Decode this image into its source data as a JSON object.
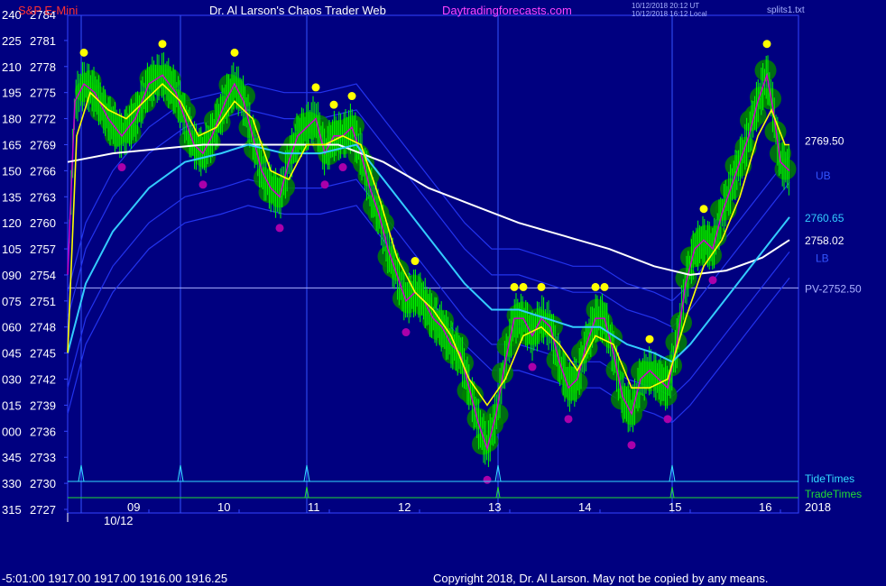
{
  "header": {
    "instrument": "S&P E-Mini",
    "site_title": "Dr. Al Larson's Chaos Trader Web",
    "site_url": "Daytradingforecasts.com",
    "ut_stamp": "10/12/2018 20:12 UT",
    "local_stamp": "10/12/2018 16:12 Local",
    "corner_label": "splits1.txt"
  },
  "footer": {
    "readout": "-5:01:00  1917.00 1917.00 1916.00 1916.25",
    "copyright": "Copyright 2018, Dr. Al Larson. May not be copied by any means."
  },
  "colors": {
    "background": "#000080",
    "price": "#00ff00",
    "blob": "#008000",
    "fast_average": "#ffff00",
    "slow_average": "#ffffff",
    "mid_average": "#33ccff",
    "bands": "#2233ee",
    "magenta": "#cc00cc",
    "dot_high": "#ffff00",
    "dot_low": "#aa00aa"
  },
  "chart_data": {
    "type": "line",
    "y_axis": {
      "ticks": [
        2784,
        2781,
        2778,
        2775,
        2772,
        2769,
        2766,
        2763,
        2760,
        2757,
        2754,
        2751,
        2748,
        2745,
        2742,
        2739,
        2736,
        2733,
        2730,
        2727
      ],
      "degree_labels": [
        "240",
        "225",
        "210",
        "195",
        "180",
        "165",
        "150",
        "135",
        "120",
        "105",
        "090",
        "075",
        "060",
        "045",
        "030",
        "015",
        "000",
        "345",
        "330",
        "315"
      ],
      "range": [
        2727,
        2784
      ]
    },
    "x_axis": {
      "range": [
        8.1,
        16.2
      ],
      "hour_ticks": [
        {
          "x": 9,
          "label": "09"
        },
        {
          "x": 10,
          "label": "10"
        },
        {
          "x": 11,
          "label": "11"
        },
        {
          "x": 12,
          "label": "12"
        },
        {
          "x": 13,
          "label": "13"
        },
        {
          "x": 14,
          "label": "14"
        },
        {
          "x": 15,
          "label": "15"
        },
        {
          "x": 16,
          "label": "16"
        }
      ],
      "date_label": "10/12"
    },
    "price_close": [
      [
        8.1,
        2754
      ],
      [
        8.18,
        2774
      ],
      [
        8.28,
        2776
      ],
      [
        8.4,
        2775
      ],
      [
        8.55,
        2772
      ],
      [
        8.7,
        2770
      ],
      [
        8.85,
        2772
      ],
      [
        9.0,
        2776
      ],
      [
        9.15,
        2777
      ],
      [
        9.3,
        2775
      ],
      [
        9.4,
        2772
      ],
      [
        9.5,
        2769
      ],
      [
        9.6,
        2768
      ],
      [
        9.7,
        2770
      ],
      [
        9.85,
        2774
      ],
      [
        9.95,
        2776
      ],
      [
        10.05,
        2774
      ],
      [
        10.15,
        2770
      ],
      [
        10.25,
        2766
      ],
      [
        10.35,
        2764
      ],
      [
        10.45,
        2763
      ],
      [
        10.55,
        2767
      ],
      [
        10.65,
        2770
      ],
      [
        10.75,
        2771
      ],
      [
        10.85,
        2772
      ],
      [
        10.95,
        2768
      ],
      [
        11.05,
        2770
      ],
      [
        11.15,
        2770
      ],
      [
        11.25,
        2771
      ],
      [
        11.35,
        2768
      ],
      [
        11.45,
        2764
      ],
      [
        11.55,
        2761
      ],
      [
        11.65,
        2757
      ],
      [
        11.75,
        2754
      ],
      [
        11.85,
        2751
      ],
      [
        11.95,
        2752
      ],
      [
        12.05,
        2751
      ],
      [
        12.15,
        2749
      ],
      [
        12.25,
        2748
      ],
      [
        12.35,
        2746
      ],
      [
        12.45,
        2745
      ],
      [
        12.55,
        2741
      ],
      [
        12.65,
        2737
      ],
      [
        12.75,
        2734
      ],
      [
        12.85,
        2738
      ],
      [
        12.95,
        2744
      ],
      [
        13.05,
        2749
      ],
      [
        13.15,
        2749
      ],
      [
        13.25,
        2747
      ],
      [
        13.35,
        2749
      ],
      [
        13.45,
        2748
      ],
      [
        13.55,
        2744
      ],
      [
        13.65,
        2741
      ],
      [
        13.75,
        2742
      ],
      [
        13.85,
        2746
      ],
      [
        13.95,
        2749
      ],
      [
        14.05,
        2749
      ],
      [
        14.15,
        2745
      ],
      [
        14.25,
        2740
      ],
      [
        14.35,
        2738
      ],
      [
        14.45,
        2742
      ],
      [
        14.55,
        2743
      ],
      [
        14.65,
        2742
      ],
      [
        14.75,
        2741
      ],
      [
        14.85,
        2746
      ],
      [
        14.95,
        2753
      ],
      [
        15.05,
        2757
      ],
      [
        15.15,
        2758
      ],
      [
        15.25,
        2757
      ],
      [
        15.35,
        2761
      ],
      [
        15.45,
        2764
      ],
      [
        15.55,
        2767
      ],
      [
        15.65,
        2770
      ],
      [
        15.75,
        2774
      ],
      [
        15.85,
        2777
      ],
      [
        15.92,
        2773
      ],
      [
        16.0,
        2767
      ],
      [
        16.1,
        2766
      ]
    ],
    "series": [
      {
        "name": "",
        "values": [
          [
            8.1,
            2745
          ],
          [
            8.2,
            2770
          ],
          [
            8.35,
            2775
          ],
          [
            8.55,
            2773
          ],
          [
            8.75,
            2772
          ],
          [
            8.95,
            2774
          ],
          [
            9.15,
            2776
          ],
          [
            9.35,
            2774
          ],
          [
            9.55,
            2770
          ],
          [
            9.75,
            2771
          ],
          [
            9.95,
            2774
          ],
          [
            10.15,
            2772
          ],
          [
            10.35,
            2766
          ],
          [
            10.55,
            2765
          ],
          [
            10.75,
            2769
          ],
          [
            10.95,
            2769
          ],
          [
            11.15,
            2770
          ],
          [
            11.35,
            2769
          ],
          [
            11.55,
            2763
          ],
          [
            11.75,
            2756
          ],
          [
            11.95,
            2752
          ],
          [
            12.15,
            2750
          ],
          [
            12.35,
            2747
          ],
          [
            12.55,
            2742
          ],
          [
            12.75,
            2739
          ],
          [
            12.95,
            2742
          ],
          [
            13.15,
            2747
          ],
          [
            13.35,
            2748
          ],
          [
            13.55,
            2746
          ],
          [
            13.75,
            2743
          ],
          [
            13.95,
            2747
          ],
          [
            14.15,
            2746
          ],
          [
            14.35,
            2741
          ],
          [
            14.55,
            2741
          ],
          [
            14.75,
            2742
          ],
          [
            14.95,
            2749
          ],
          [
            15.15,
            2755
          ],
          [
            15.35,
            2758
          ],
          [
            15.55,
            2763
          ],
          [
            15.75,
            2770
          ],
          [
            15.9,
            2773
          ],
          [
            16.05,
            2769
          ],
          [
            16.1,
            2769
          ]
        ]
      },
      {
        "name": "",
        "values": [
          [
            8.1,
            2745
          ],
          [
            8.3,
            2753
          ],
          [
            8.6,
            2759
          ],
          [
            9.0,
            2764
          ],
          [
            9.4,
            2767
          ],
          [
            9.8,
            2768
          ],
          [
            10.1,
            2769
          ],
          [
            10.5,
            2768
          ],
          [
            10.9,
            2768
          ],
          [
            11.3,
            2769
          ],
          [
            11.6,
            2765
          ],
          [
            11.9,
            2761
          ],
          [
            12.2,
            2757
          ],
          [
            12.5,
            2753
          ],
          [
            12.8,
            2750
          ],
          [
            13.1,
            2750
          ],
          [
            13.4,
            2749
          ],
          [
            13.7,
            2748
          ],
          [
            14.0,
            2748
          ],
          [
            14.3,
            2746
          ],
          [
            14.6,
            2745
          ],
          [
            14.8,
            2744
          ],
          [
            15.0,
            2746
          ],
          [
            15.3,
            2750
          ],
          [
            15.6,
            2754
          ],
          [
            15.9,
            2758
          ],
          [
            16.1,
            2760.65
          ]
        ]
      },
      {
        "name": "",
        "values": [
          [
            8.1,
            2767
          ],
          [
            8.6,
            2768
          ],
          [
            9.1,
            2768.5
          ],
          [
            9.6,
            2769
          ],
          [
            10.1,
            2769
          ],
          [
            10.6,
            2769
          ],
          [
            11.1,
            2769
          ],
          [
            11.6,
            2767
          ],
          [
            12.1,
            2764
          ],
          [
            12.6,
            2762
          ],
          [
            13.1,
            2760
          ],
          [
            13.6,
            2758.5
          ],
          [
            14.1,
            2757
          ],
          [
            14.6,
            2755
          ],
          [
            15.0,
            2754
          ],
          [
            15.4,
            2754.5
          ],
          [
            15.8,
            2756
          ],
          [
            16.1,
            2758.02
          ]
        ]
      }
    ],
    "price_labels": [
      {
        "text": "2769.50",
        "y": 2769.5
      },
      {
        "text": "UB",
        "y": 2765.5
      },
      {
        "text": "2760.65",
        "y": 2760.65
      },
      {
        "text": "2758.02",
        "y": 2758.02
      },
      {
        "text": "LB",
        "y": 2756
      },
      {
        "text": "PV-2752.50",
        "y": 2752.5
      }
    ],
    "pivot": 2752.5,
    "time_lines": [
      8.25,
      9.35,
      10.75,
      12.87,
      14.8
    ],
    "trade_lines": [
      10.75,
      12.87,
      14.8
    ],
    "tide_label": "TideTimes",
    "trade_label": "TradeTimes",
    "year_label": "2018"
  }
}
